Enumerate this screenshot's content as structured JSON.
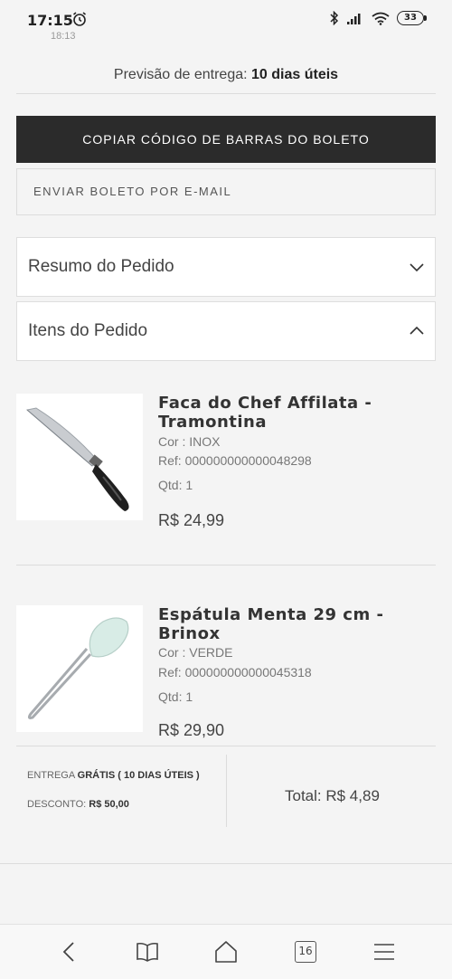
{
  "status_bar": {
    "time": "17:15",
    "battery": "33"
  },
  "ghost_time": "18:13",
  "delivery": {
    "label": "Previsão de entrega:",
    "value": "10 dias úteis"
  },
  "actions": {
    "copy_barcode": "COPIAR CÓDIGO DE BARRAS DO BOLETO",
    "email_boleto": "ENVIAR BOLETO POR E-MAIL"
  },
  "accordions": {
    "summary": "Resumo do Pedido",
    "items": "Itens do Pedido"
  },
  "items": [
    {
      "name": "Faca do Chef Affilata - Tramontina",
      "color": "Cor : INOX",
      "ref": "Ref: 000000000000048298",
      "qty": "Qtd: 1",
      "price": "R$ 24,99"
    },
    {
      "name": "Espátula Menta 29 cm - Brinox",
      "color": "Cor : VERDE",
      "ref": "Ref: 000000000000045318",
      "qty": "Qtd: 1",
      "price": "R$ 29,90"
    }
  ],
  "summary": {
    "delivery_label": "ENTREGA",
    "delivery_value": "GRÁTIS ( 10 DIAS ÚTEIS )",
    "discount_label": "DESCONTO:",
    "discount_value": "R$ 50,00",
    "total": "Total: R$ 4,89"
  },
  "nav": {
    "tabs_count": "16"
  },
  "colors": {
    "background": "#f4f4f4",
    "primary_button": "#2b2b2b"
  },
  "icons": [
    "alarm-icon",
    "bluetooth-icon",
    "signal-icon",
    "wifi-icon",
    "battery-icon",
    "chevron-down-icon",
    "chevron-up-icon",
    "back-icon",
    "book-icon",
    "home-icon",
    "tabs-icon",
    "menu-icon"
  ]
}
